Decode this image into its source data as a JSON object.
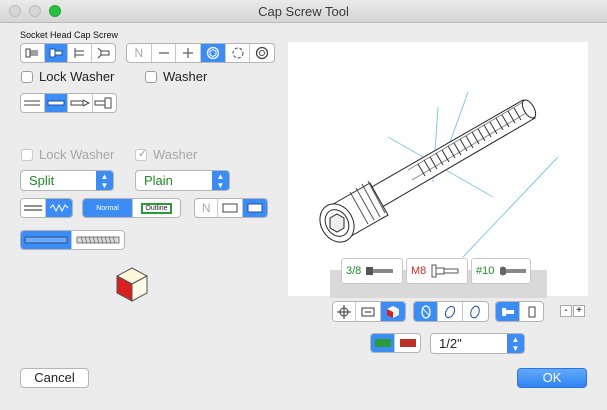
{
  "window": {
    "title": "Cap Screw Tool"
  },
  "screw_type_label": "Socket Head Cap Screw",
  "head_style_segment": {
    "selected_index": 1,
    "icons": [
      "head-flush-icon",
      "head-socket-icon",
      "head-side-icon",
      "head-countersunk-icon"
    ]
  },
  "drive_segment": {
    "selected_index": 3,
    "icons": [
      "none-n-icon",
      "slot-icon",
      "phillips-icon",
      "hex-socket-icon",
      "torx-icon",
      "spline-icon"
    ],
    "n_label": "N"
  },
  "lock_washer_top": {
    "label": "Lock Washer",
    "checked": false
  },
  "washer_top": {
    "label": "Washer",
    "checked": false
  },
  "thread_segment": {
    "selected_index": 1
  },
  "lock_washer_bottom": {
    "label": "Lock Washer",
    "checked": false,
    "enabled": false
  },
  "washer_bottom": {
    "label": "Washer",
    "checked": true,
    "enabled": false
  },
  "lock_type_popup": {
    "value": "Split"
  },
  "washer_type_popup": {
    "value": "Plain"
  },
  "line_segment": {
    "selected_index": 1
  },
  "render_segment": {
    "normal_label": "Normal",
    "outline_label": "Outline",
    "selected_index": 0
  },
  "fill_segment": {
    "n_label": "N",
    "selected_index": 2
  },
  "thread_display_segment": {
    "selected_index": 0
  },
  "preview_tags": [
    {
      "size": "3/8",
      "color": "#208a26"
    },
    {
      "size": "M8",
      "color": "#c0302a"
    },
    {
      "size": "#10",
      "color": "#208a26"
    }
  ],
  "view_segment": {
    "selected_index": 2
  },
  "orient_segment": {
    "selected_index": 0
  },
  "align_segment": {
    "selected_index": 0
  },
  "zoom": {
    "minus": "-",
    "plus": "+"
  },
  "color_segment": {
    "selected_index": 0,
    "colors": [
      "#2a9a3a",
      "#c0302a"
    ]
  },
  "length_popup": {
    "value": "1/2\""
  },
  "cancel_button": "Cancel",
  "ok_button": "OK",
  "colors": {
    "accent": "#3b8cf5",
    "green": "#208a26",
    "red": "#c0302a"
  }
}
